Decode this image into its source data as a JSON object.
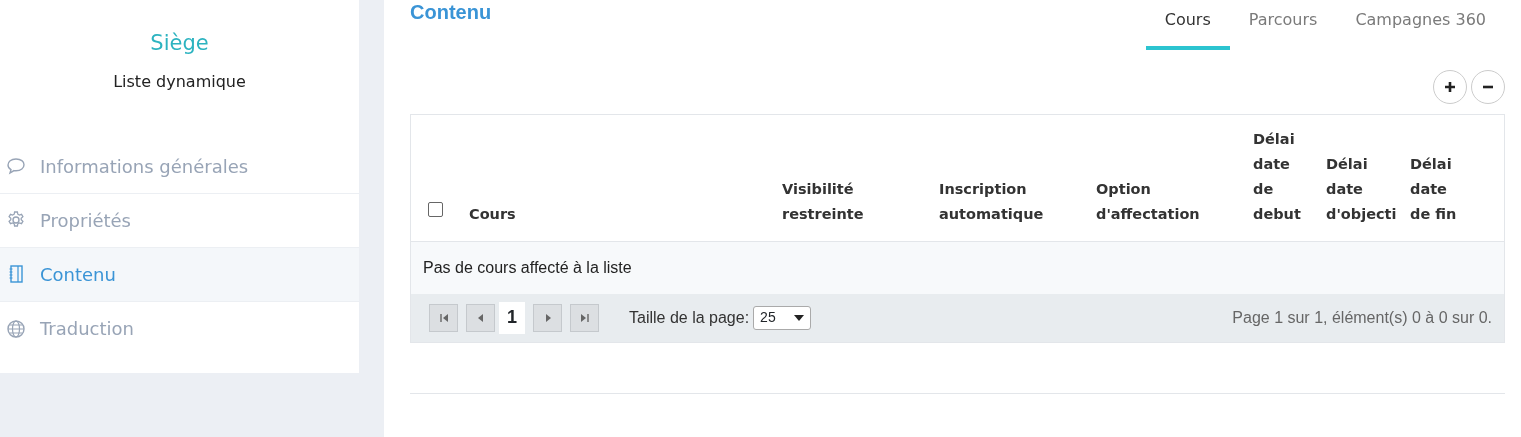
{
  "sidebar": {
    "title": "Siège",
    "subtitle": "Liste dynamique",
    "items": [
      {
        "label": "Informations générales",
        "selected": false
      },
      {
        "label": "Propriétés",
        "selected": false
      },
      {
        "label": "Contenu",
        "selected": true
      },
      {
        "label": "Traduction",
        "selected": false
      }
    ]
  },
  "page_title": "Contenu",
  "tabs": [
    {
      "label": "Cours",
      "selected": true
    },
    {
      "label": "Parcours",
      "selected": false
    },
    {
      "label": "Campagnes 360",
      "selected": false
    }
  ],
  "actions": [
    {
      "kind": "add"
    },
    {
      "kind": "remove"
    }
  ],
  "table": {
    "select_all": {
      "checked": false
    },
    "columns": [
      "Cours",
      "Visibilité restreinte",
      "Inscription automatique",
      "Option d'affectation",
      "Délai date de debut",
      "Délai date d'objecti",
      "Délai date de fin"
    ],
    "empty_message": "Pas de cours affecté à la liste"
  },
  "pager": {
    "current_page": "1",
    "page_size_label": "Taille de la page:",
    "page_size": "25",
    "summary": "Page 1 sur 1, élément(s) 0 à 0 sur 0."
  }
}
